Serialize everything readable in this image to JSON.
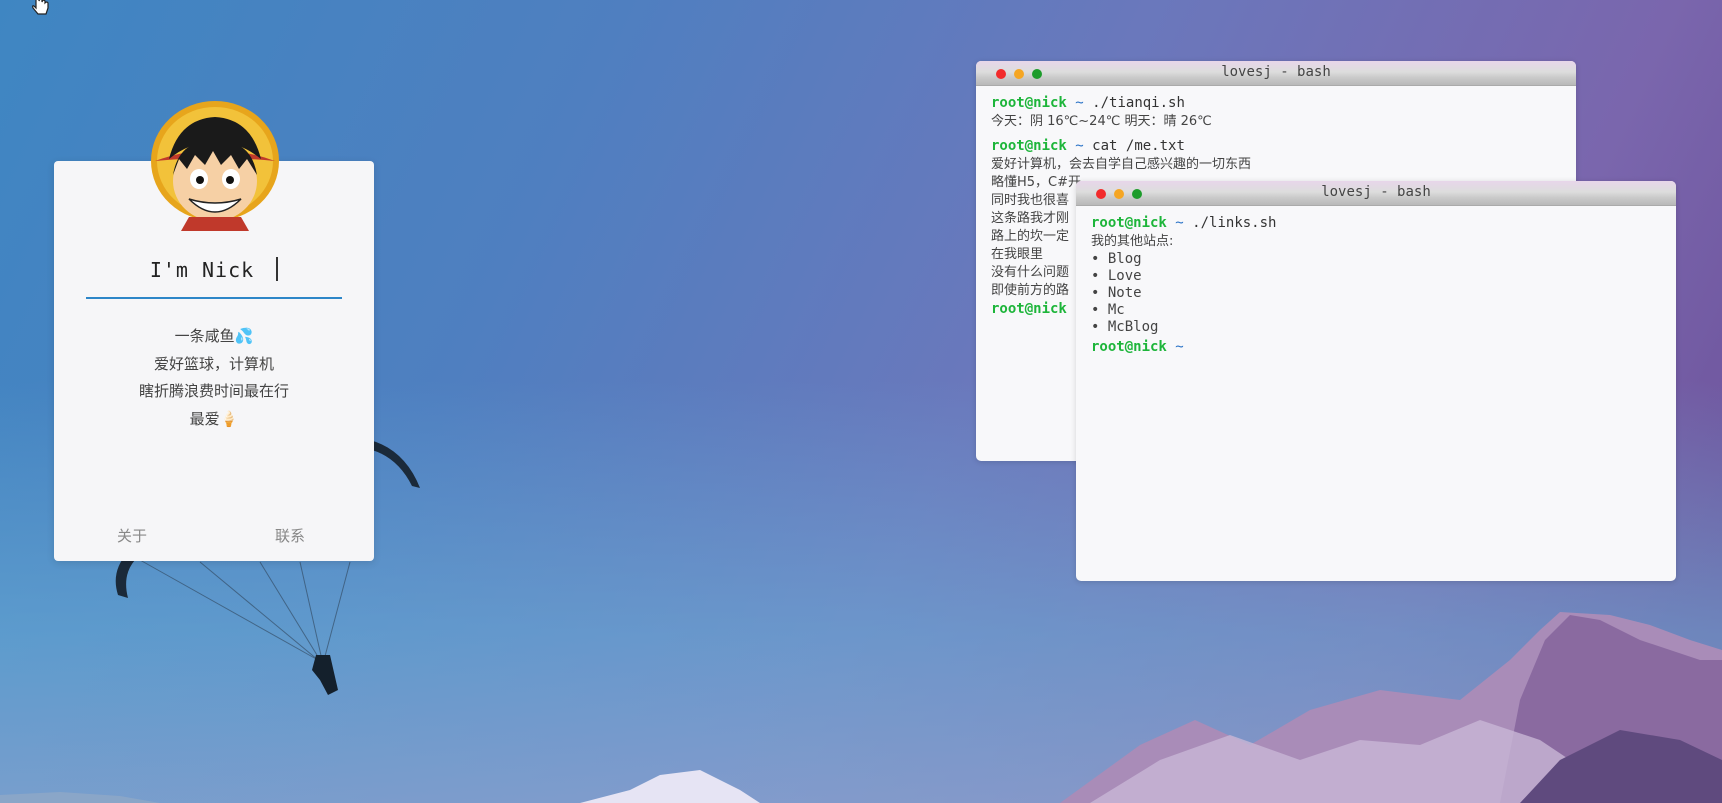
{
  "profile": {
    "name": "I'm Nick",
    "bio": [
      "一条咸鱼💦",
      "爱好篮球，计算机",
      "瞎折腾浪费时间最在行",
      "最爱🍦"
    ],
    "links": {
      "about": "关于",
      "contact": "联系"
    }
  },
  "terminal_back": {
    "title": "lovesj - bash",
    "user": "root@nick",
    "tilde": "~",
    "cmd1": "./tianqi.sh",
    "weather": "今天：阴 16℃~24℃  明天：晴 26℃",
    "cmd2": "cat /me.txt",
    "me_lines": [
      "爱好计算机，会去自学自己感兴趣的一切东西",
      "略懂H5，C#开",
      "同时我也很喜",
      "这条路我才刚",
      "路上的坎一定",
      "在我眼里",
      "没有什么问题",
      "即使前方的路"
    ]
  },
  "terminal_front": {
    "title": "lovesj - bash",
    "user": "root@nick",
    "tilde": "~",
    "cmd": "./links.sh",
    "heading": "我的其他站点:",
    "links": [
      "Blog",
      "Love",
      "Note",
      "Mc",
      "McBlog"
    ]
  },
  "colors": {
    "accent": "#2d86c8",
    "prompt_user": "#1db53a",
    "prompt_tilde": "#2b73c7"
  }
}
